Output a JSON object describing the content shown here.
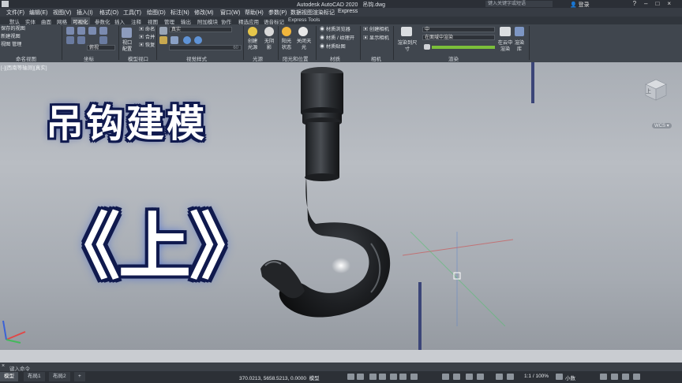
{
  "window": {
    "title": "Autodesk AutoCAD 2020",
    "document": "吊钩.dwg",
    "search_placeholder": "键入关键字或短语",
    "login_label": "登录",
    "help_icon": "question-icon"
  },
  "menubar": [
    "文件(F)",
    "编辑(E)",
    "视图(V)",
    "插入(I)",
    "格式(O)",
    "工具(T)",
    "绘图(D)",
    "标注(N)",
    "修改(M)",
    "窗口(W)",
    "帮助(H)",
    "参数(P)",
    "数据视图",
    "渲染标记",
    "Express"
  ],
  "ribbon_tabs": [
    "默认",
    "实体",
    "曲面",
    "网格",
    "可视化",
    "参数化",
    "插入",
    "注释",
    "视图",
    "管理",
    "输出",
    "附加模块",
    "协作",
    "精选应用",
    "语音标记",
    "Express Tools"
  ],
  "active_tab": "可视化",
  "ribbon": {
    "named_views": {
      "saved_views": "保存的视图",
      "new_view": "新建视图",
      "view_manager": "视图 管理",
      "title": "命名视图"
    },
    "coordinates": {
      "combo": "俯视",
      "title": "坐标"
    },
    "model_viewports": {
      "viewport_config": "视口配置",
      "name": "命名",
      "merge": "合并",
      "restore": "恢复",
      "title": "模型视口"
    },
    "visual_styles": {
      "combo": "真实",
      "value": "60",
      "title": "视觉样式"
    },
    "lights": {
      "create_light": "创建光源",
      "no_shadow": "无阴影",
      "title": "光源"
    },
    "sun_location": {
      "sun_status": "阳光状态",
      "sky_off": "关闭天光",
      "title": "阳光和位置"
    },
    "materials": {
      "browser": "材质浏览器",
      "mapping": "材质 / 纹理开",
      "mapping2": "材质贴图",
      "title": "材质"
    },
    "camera": {
      "create": "创建相机",
      "show": "显示相机",
      "title": "相机"
    },
    "render": {
      "size": "渲染到尺寸",
      "quality": "中",
      "target": "在面域中渲染",
      "cloud": "在云中渲染",
      "gallery": "渲染库",
      "title": "渲染"
    }
  },
  "viewport": {
    "label": "[-][西南等轴测][真实]",
    "headline_1": "吊钩建模",
    "headline_2": "《上》",
    "wcs": "WCS ▾",
    "viewcube_face": "上"
  },
  "command": {
    "prompt": "键入命令"
  },
  "layout_tabs": [
    "模型",
    "布局1",
    "布局2",
    "+"
  ],
  "status": {
    "coords": "370.0213, 5658.5213, 0.0000",
    "mode": "模型",
    "scale": "1:1 / 100%",
    "units": "小数"
  },
  "colors": {
    "ribbon": "#40464e",
    "accent": "#7bbf3a",
    "headline_outline": "#101a4e"
  }
}
